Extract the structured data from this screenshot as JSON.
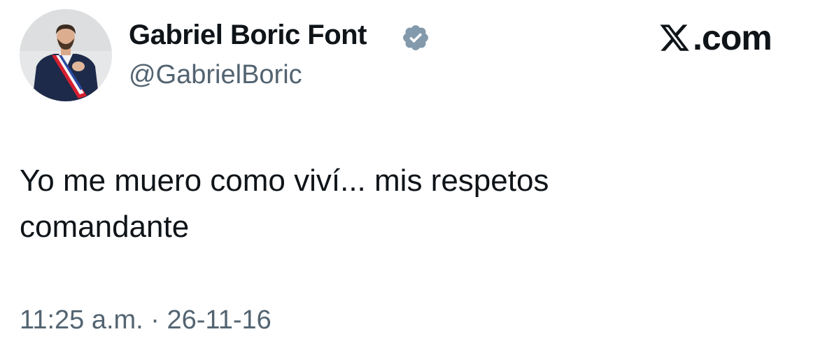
{
  "author": {
    "display_name": "Gabriel Boric Font",
    "handle": "@GabrielBoric",
    "verified": true,
    "verified_color": "#829aab"
  },
  "brand": {
    "logo_icon": "x-logo-icon",
    "text": ".com"
  },
  "tweet": {
    "text": "Yo me muero como viví... mis respetos\ncomandante",
    "timestamp": "11:25 a.m. · 26-11-16"
  },
  "colors": {
    "primary_text": "#0f1419",
    "secondary_text": "#536471",
    "background": "#ffffff"
  }
}
